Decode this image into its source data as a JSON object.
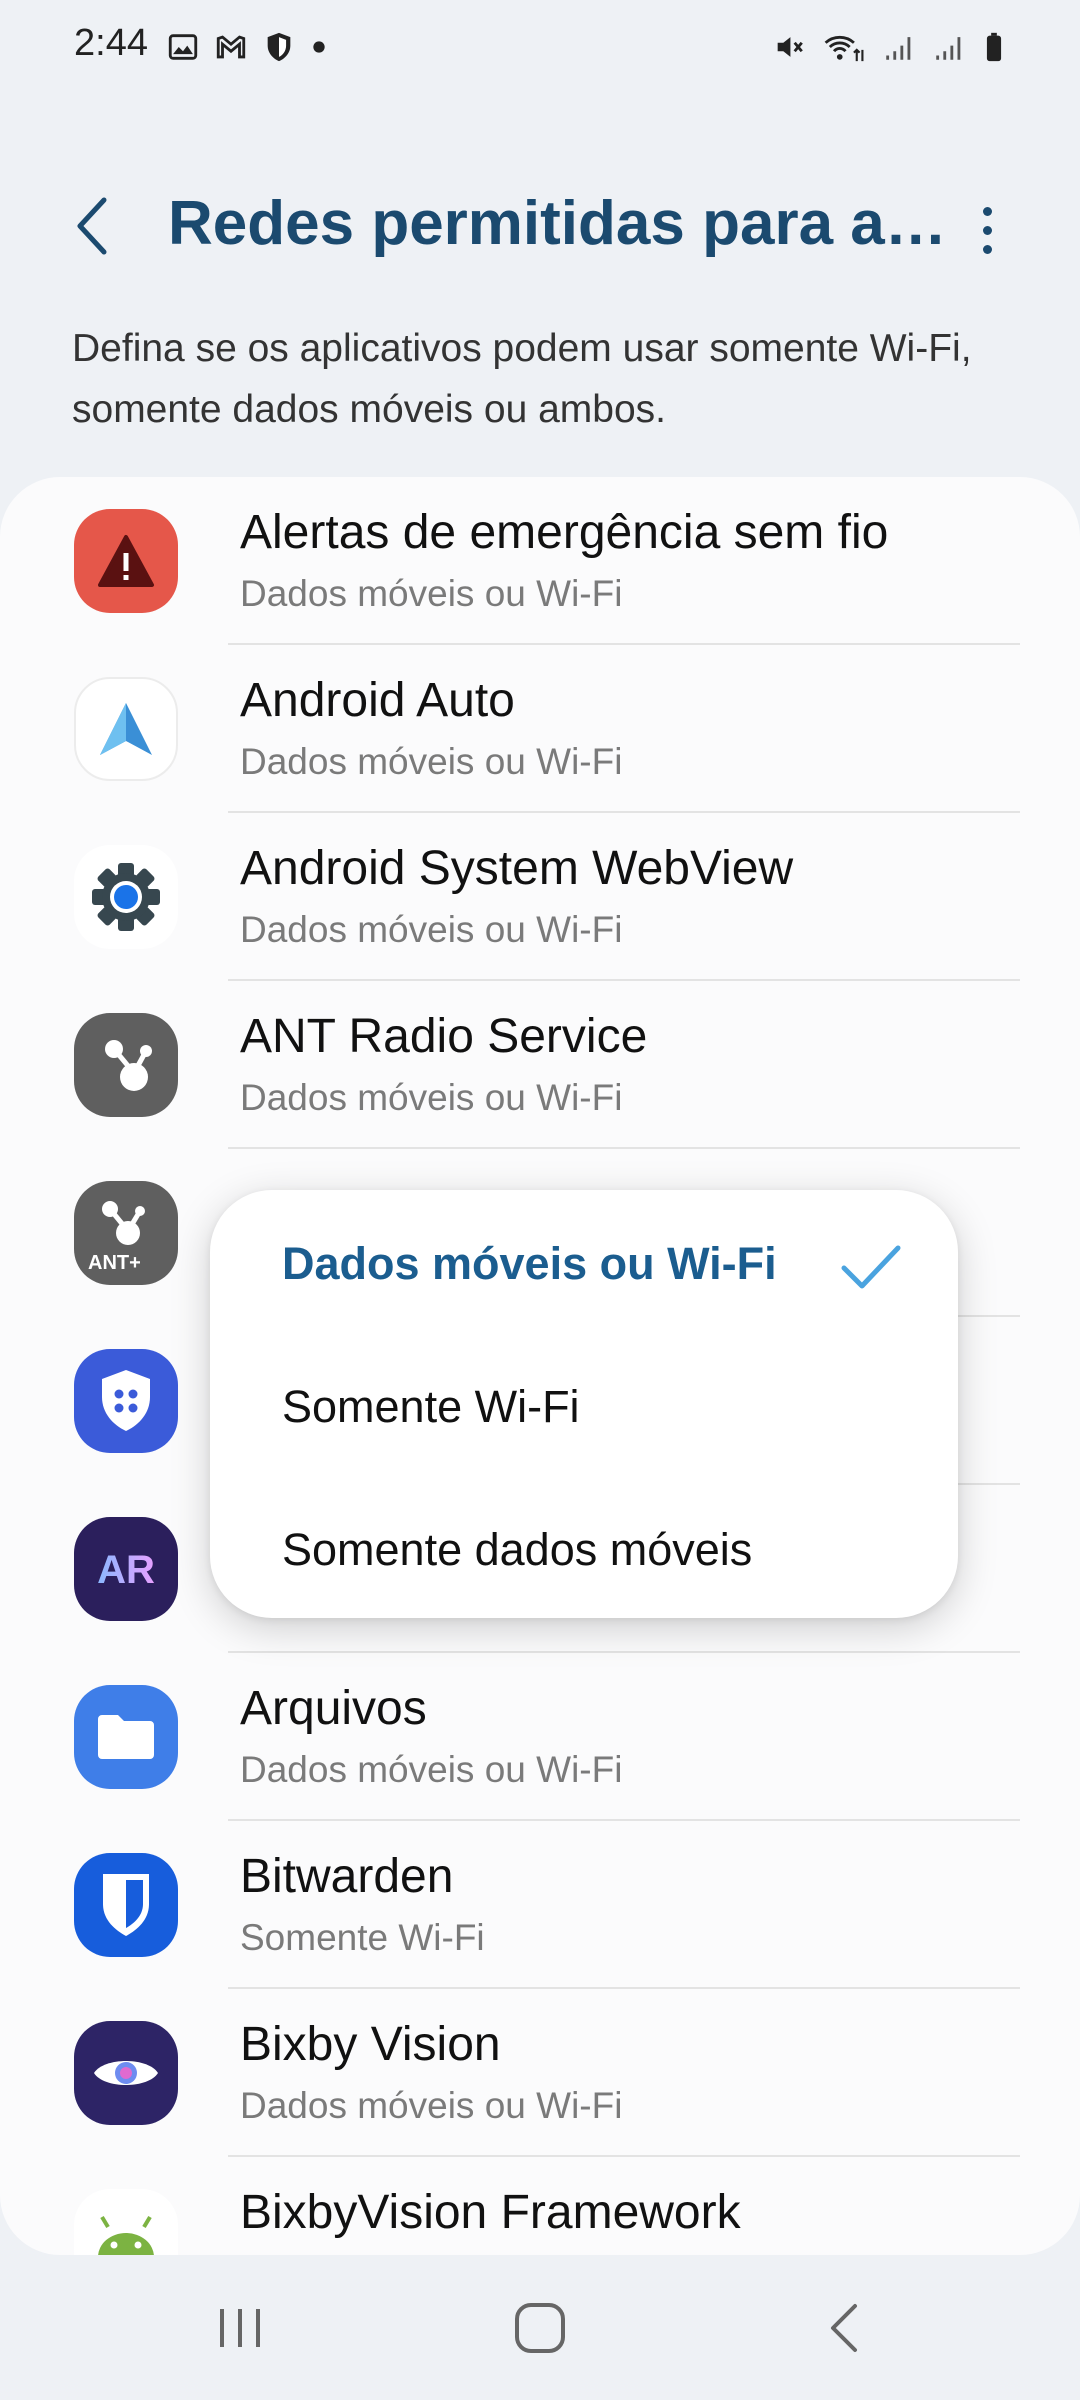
{
  "status_bar": {
    "time": "2:44",
    "left_icons": [
      "gallery-icon",
      "gmail-icon",
      "shield-icon",
      "dot-icon"
    ],
    "right_icons": [
      "mute-icon",
      "wifi-icon",
      "signal-icon",
      "signal-icon",
      "battery-icon"
    ]
  },
  "header": {
    "title": "Redes permitidas para aplicativos",
    "back_icon": "chevron-left-icon",
    "more_icon": "more-vert-icon"
  },
  "description": "Defina se os aplicativos podem usar somente Wi-Fi, somente dados móveis ou ambos.",
  "apps": [
    {
      "name": "Alertas de emergência sem fio",
      "setting": "Dados móveis ou Wi-Fi",
      "icon": "emergency-alert-icon"
    },
    {
      "name": "Android Auto",
      "setting": "Dados móveis ou Wi-Fi",
      "icon": "android-auto-icon"
    },
    {
      "name": "Android System WebView",
      "setting": "Dados móveis ou Wi-Fi",
      "icon": "webview-gear-icon"
    },
    {
      "name": "ANT Radio Service",
      "setting": "Dados móveis ou Wi-Fi",
      "icon": "ant-radio-icon"
    },
    {
      "name": "",
      "setting": "",
      "icon": "ant-plus-icon"
    },
    {
      "name": "",
      "setting": "",
      "icon": "security-shield-icon"
    },
    {
      "name": "",
      "setting": "",
      "icon": "ar-icon"
    },
    {
      "name": "Arquivos",
      "setting": "Dados móveis ou Wi-Fi",
      "icon": "folder-icon"
    },
    {
      "name": "Bitwarden",
      "setting": "Somente Wi-Fi",
      "icon": "bitwarden-icon"
    },
    {
      "name": "Bixby Vision",
      "setting": "Dados móveis ou Wi-Fi",
      "icon": "bixby-vision-icon"
    },
    {
      "name": "BixbyVision Framework",
      "setting": "",
      "icon": "android-icon"
    }
  ],
  "dropdown": {
    "options": [
      "Dados móveis ou Wi-Fi",
      "Somente Wi-Fi",
      "Somente dados móveis"
    ],
    "selected": "Dados móveis ou Wi-Fi"
  },
  "nav_bar": {
    "recents_icon": "recents-icon",
    "home_icon": "home-icon",
    "back_icon": "back-icon"
  },
  "colors": {
    "background": "#eef1f5",
    "card": "#fbfbfc",
    "title": "#1b4a6f",
    "accent": "#1b5d8f",
    "check": "#4aa3df"
  }
}
